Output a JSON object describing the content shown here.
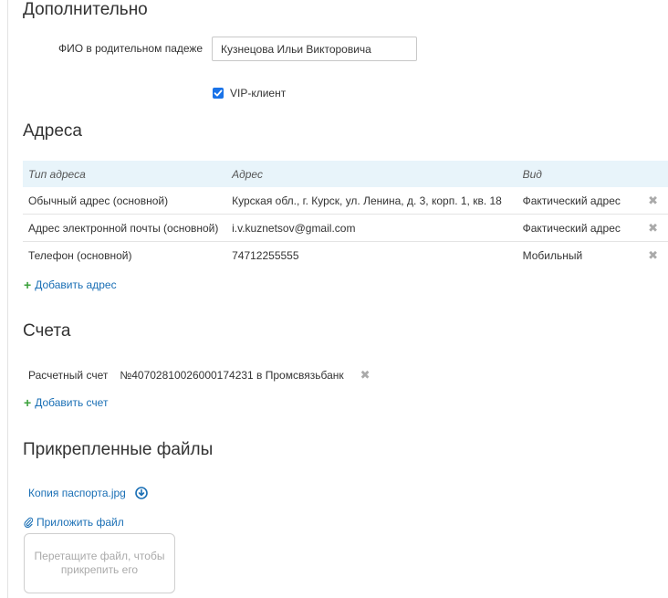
{
  "sections": {
    "extra": "Дополнительно",
    "addresses": "Адреса",
    "accounts": "Счета",
    "files": "Прикрепленные файлы"
  },
  "extra": {
    "genitive_label": "ФИО в родительном падеже",
    "genitive_value": "Кузнецова Ильи Викторовича",
    "vip_label": "VIP-клиент",
    "vip_checked": true
  },
  "addresses": {
    "headers": {
      "type": "Тип адреса",
      "address": "Адрес",
      "kind": "Вид"
    },
    "rows": [
      {
        "type": "Обычный адрес (основной)",
        "address": "Курская обл., г. Курск, ул. Ленина, д. 3, корп. 1, кв. 18",
        "kind": "Фактический адрес"
      },
      {
        "type": "Адрес электронной почты (основной)",
        "address": "i.v.kuznetsov@gmail.com",
        "kind": "Фактический адрес"
      },
      {
        "type": "Телефон (основной)",
        "address": "74712255555",
        "kind": "Мобильный"
      }
    ],
    "add_label": "Добавить адрес"
  },
  "accounts": {
    "items": [
      {
        "type": "Расчетный счет",
        "value": "№40702810026000174231 в Промсвязьбанк"
      }
    ],
    "add_label": "Добавить счет"
  },
  "files": {
    "items": [
      {
        "name": "Копия паспорта.jpg"
      }
    ],
    "attach_label": "Приложить файл",
    "dropzone_text": "Перетащите файл, чтобы прикрепить его"
  },
  "colors": {
    "link": "#1a6fb5",
    "plus": "#3aa13a",
    "table_header_bg": "#e8f4fa",
    "checkbox": "#1a73e8"
  }
}
